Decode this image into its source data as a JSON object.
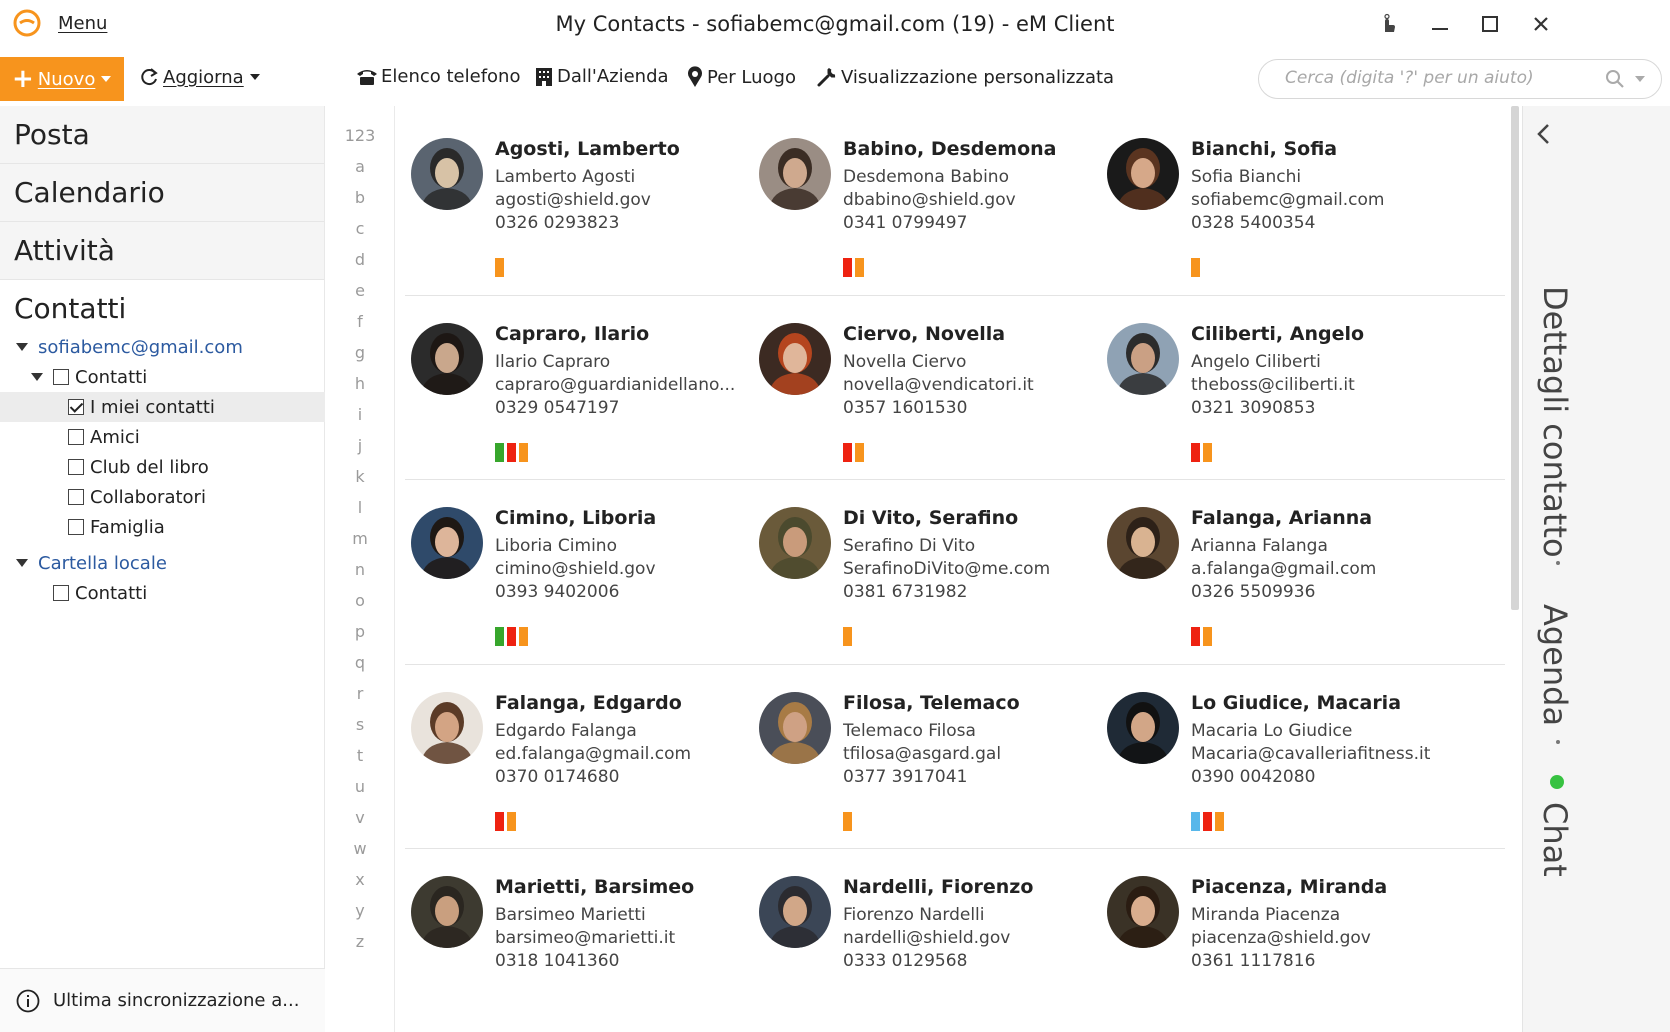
{
  "titlebar": {
    "menu_label": "Menu",
    "window_title": "My Contacts - sofiabemc@gmail.com (19) - eM Client",
    "accent_color": "#f7941d"
  },
  "toolbar": {
    "new_label": "Nuovo",
    "refresh_label": "Aggiorna",
    "views": [
      {
        "label": "Elenco telefono",
        "icon": "phone-icon"
      },
      {
        "label": "Dall'Azienda",
        "icon": "building-icon"
      },
      {
        "label": "Per Luogo",
        "icon": "map-pin-icon"
      },
      {
        "label": "Visualizzazione personalizzata",
        "icon": "wrench-icon"
      }
    ],
    "search_placeholder": "Cerca (digita '?' per un aiuto)"
  },
  "sidebar": {
    "nav": [
      "Posta",
      "Calendario",
      "Attività",
      "Contatti"
    ],
    "tree": {
      "account": "sofiabemc@gmail.com",
      "folder": "Contatti",
      "groups": [
        {
          "label": "I miei contatti",
          "checked": true
        },
        {
          "label": "Amici",
          "checked": false
        },
        {
          "label": "Club del libro",
          "checked": false
        },
        {
          "label": "Collaboratori",
          "checked": false
        },
        {
          "label": "Famiglia",
          "checked": false
        }
      ],
      "local_folder": "Cartella locale",
      "local_contacts": "Contatti"
    },
    "sync_status": "Ultima sincronizzazione a..."
  },
  "alphabet": [
    "123",
    "a",
    "b",
    "c",
    "d",
    "e",
    "f",
    "g",
    "h",
    "i",
    "j",
    "k",
    "l",
    "m",
    "n",
    "o",
    "p",
    "q",
    "r",
    "s",
    "t",
    "u",
    "v",
    "w",
    "x",
    "y",
    "z"
  ],
  "contacts": [
    {
      "display": "Agosti, Lamberto",
      "full": "Lamberto Agosti",
      "email": "agosti@shield.gov",
      "phone": "0326 0293823",
      "tags": [
        "#f7941d"
      ],
      "avatar": [
        "#5a6470",
        "#d7c2a6",
        "#2a2a2a"
      ]
    },
    {
      "display": "Babino, Desdemona",
      "full": "Desdemona Babino",
      "email": "dbabino@shield.gov",
      "phone": "0341 0799497",
      "tags": [
        "#ee2211",
        "#f7941d"
      ],
      "avatar": [
        "#9a8d84",
        "#cfa98e",
        "#3b2d24"
      ]
    },
    {
      "display": "Bianchi, Sofia",
      "full": "Sofia Bianchi",
      "email": "sofiabemc@gmail.com",
      "phone": "0328 5400354",
      "tags": [
        "#f7941d"
      ],
      "avatar": [
        "#1a1a1a",
        "#d6a889",
        "#5a3420"
      ]
    },
    {
      "display": "Capraro, Ilario",
      "full": "Ilario Capraro",
      "email": "capraro@guardianidellano...",
      "phone": "0329 0547197",
      "tags": [
        "#37a62c",
        "#ee2211",
        "#f7941d"
      ],
      "avatar": [
        "#2b2b2b",
        "#c9a78c",
        "#1d1714"
      ]
    },
    {
      "display": "Ciervo, Novella",
      "full": "Novella Ciervo",
      "email": "novella@vendicatori.it",
      "phone": "0357 1601530",
      "tags": [
        "#ee2211",
        "#f7941d"
      ],
      "avatar": [
        "#3c2a22",
        "#e0b69a",
        "#b5451e"
      ]
    },
    {
      "display": "Ciliberti, Angelo",
      "full": "Angelo Ciliberti",
      "email": "theboss@ciliberti.it",
      "phone": "0321 3090853",
      "tags": [
        "#ee2211",
        "#f7941d"
      ],
      "avatar": [
        "#8fa2b4",
        "#caa084",
        "#2c2c2c"
      ]
    },
    {
      "display": "Cimino, Liboria",
      "full": "Liboria Cimino",
      "email": "cimino@shield.gov",
      "phone": "0393 9402006",
      "tags": [
        "#37a62c",
        "#ee2211",
        "#f7941d"
      ],
      "avatar": [
        "#2f4a6a",
        "#ddb59a",
        "#1e1814"
      ]
    },
    {
      "display": "Di Vito, Serafino",
      "full": "Serafino Di Vito",
      "email": "SerafinoDiVito@me.com",
      "phone": "0381 6731982",
      "tags": [
        "#f7941d"
      ],
      "avatar": [
        "#6a5a3a",
        "#c99b7b",
        "#4b4a2e"
      ]
    },
    {
      "display": "Falanga, Arianna",
      "full": "Arianna Falanga",
      "email": "a.falanga@gmail.com",
      "phone": "0326 5509936",
      "tags": [
        "#ee2211",
        "#f7941d"
      ],
      "avatar": [
        "#5b4630",
        "#d9b391",
        "#2d2118"
      ]
    },
    {
      "display": "Falanga, Edgardo",
      "full": "Edgardo Falanga",
      "email": "ed.falanga@gmail.com",
      "phone": "0370 0174680",
      "tags": [
        "#ee2211",
        "#f7941d"
      ],
      "avatar": [
        "#e9e3dc",
        "#d3a484",
        "#5b3b27"
      ]
    },
    {
      "display": "Filosa, Telemaco",
      "full": "Telemaco Filosa",
      "email": "tfilosa@asgard.gal",
      "phone": "0377 3917041",
      "tags": [
        "#f7941d"
      ],
      "avatar": [
        "#4a4e58",
        "#cfa184",
        "#a87b45"
      ]
    },
    {
      "display": "Lo Giudice, Macaria",
      "full": "Macaria Lo Giudice",
      "email": "Macaria@cavalleriafitness.it",
      "phone": "0390 0042080",
      "tags": [
        "#58b7ea",
        "#ee2211",
        "#f7941d"
      ],
      "avatar": [
        "#1f2a36",
        "#d2a687",
        "#111111"
      ]
    },
    {
      "display": "Marietti, Barsimeo",
      "full": "Barsimeo Marietti",
      "email": "barsimeo@marietti.it",
      "phone": "0318 1041360",
      "tags": [],
      "avatar": [
        "#3d3a30",
        "#c99f7f",
        "#2a2620"
      ]
    },
    {
      "display": "Nardelli, Fiorenzo",
      "full": "Fiorenzo Nardelli",
      "email": "nardelli@shield.gov",
      "phone": "0333 0129568",
      "tags": [],
      "avatar": [
        "#3b4656",
        "#d1a788",
        "#2b2b30"
      ]
    },
    {
      "display": "Piacenza, Miranda",
      "full": "Miranda Piacenza",
      "email": "piacenza@shield.gov",
      "phone": "0361 1117816",
      "tags": [],
      "avatar": [
        "#3a3226",
        "#d9ad8e",
        "#2a1c12"
      ]
    }
  ],
  "right_panel": {
    "contact_details": "Dettagli contatto",
    "agenda": "Agenda",
    "chat": "Chat",
    "online_color": "#37c241"
  }
}
